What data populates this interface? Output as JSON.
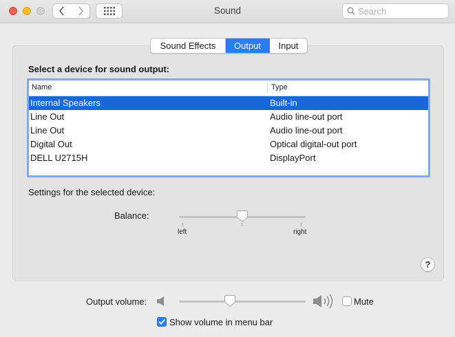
{
  "window": {
    "title": "Sound",
    "search_placeholder": "Search"
  },
  "tabs": [
    {
      "label": "Sound Effects",
      "active": false
    },
    {
      "label": "Output",
      "active": true
    },
    {
      "label": "Input",
      "active": false
    }
  ],
  "device_section": {
    "heading": "Select a device for sound output:",
    "columns": [
      "Name",
      "Type"
    ],
    "devices": [
      {
        "name": "Internal Speakers",
        "type": "Built-in",
        "selected": true
      },
      {
        "name": "Line Out",
        "type": "Audio line-out port",
        "selected": false
      },
      {
        "name": "Line Out",
        "type": "Audio line-out port",
        "selected": false
      },
      {
        "name": "Digital Out",
        "type": "Optical digital-out port",
        "selected": false
      },
      {
        "name": "DELL U2715H",
        "type": "DisplayPort",
        "selected": false
      }
    ]
  },
  "settings": {
    "heading": "Settings for the selected device:",
    "balance": {
      "label": "Balance:",
      "left_label": "left",
      "right_label": "right",
      "value": 0.5
    }
  },
  "output_volume": {
    "label": "Output volume:",
    "value": 0.4,
    "mute_label": "Mute",
    "mute_checked": false
  },
  "show_volume": {
    "label": "Show volume in menu bar",
    "checked": true
  },
  "colors": {
    "accent": "#2c7cf6",
    "selection": "#1a67da"
  }
}
